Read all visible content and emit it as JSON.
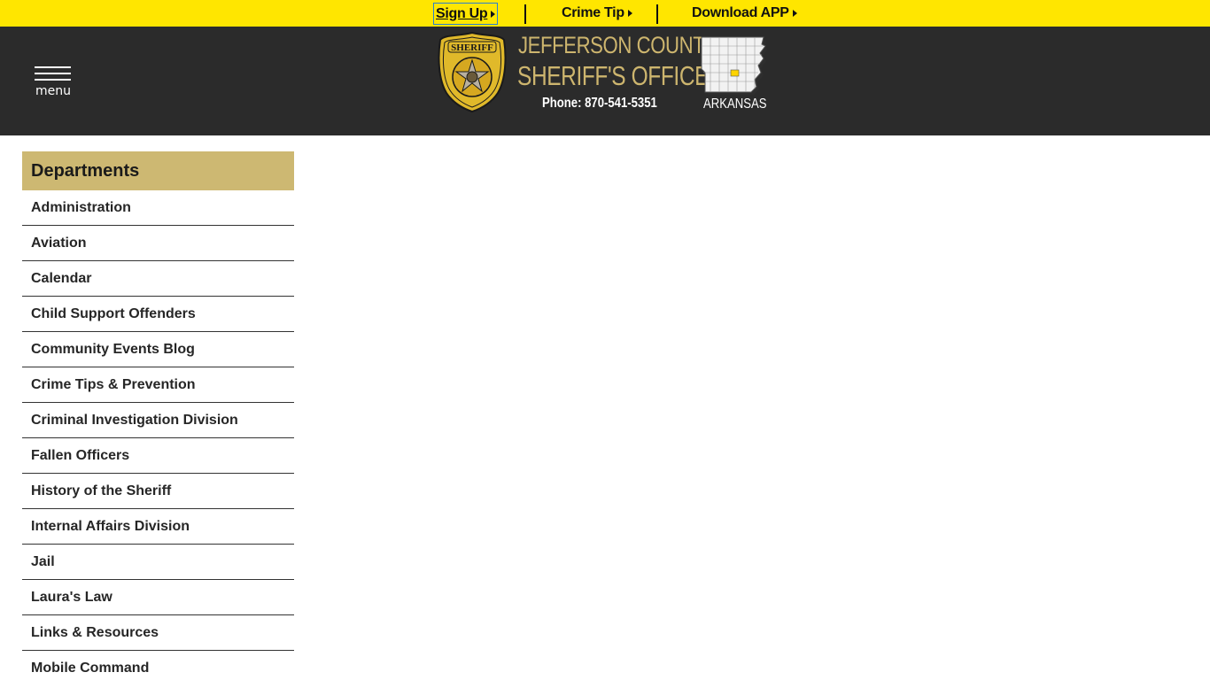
{
  "topbar": {
    "signup": "Sign Up",
    "crime_tip": "Crime Tip",
    "download_app": "Download APP"
  },
  "header": {
    "menu_label": "menu",
    "title_line1": "JEFFERSON COUNTY",
    "title_line2": "SHERIFF'S OFFICE",
    "phone": "Phone: 870-541-5351",
    "state": "ARKANSAS",
    "badge_icon": "sheriff-badge-icon",
    "badge_text": "SHERIFF",
    "colors": {
      "gold": "#cdb56e",
      "topbar": "#ffe600",
      "header_bg": "#2b2b2b"
    }
  },
  "sidebar": {
    "heading": "Departments",
    "items": [
      "Administration",
      "Aviation",
      "Calendar",
      "Child Support Offenders",
      "Community Events Blog",
      "Crime Tips & Prevention",
      "Criminal Investigation Division",
      "Fallen Officers",
      "History of the Sheriff",
      "Internal Affairs Division",
      "Jail",
      "Laura's Law",
      "Links & Resources",
      "Mobile Command"
    ]
  }
}
